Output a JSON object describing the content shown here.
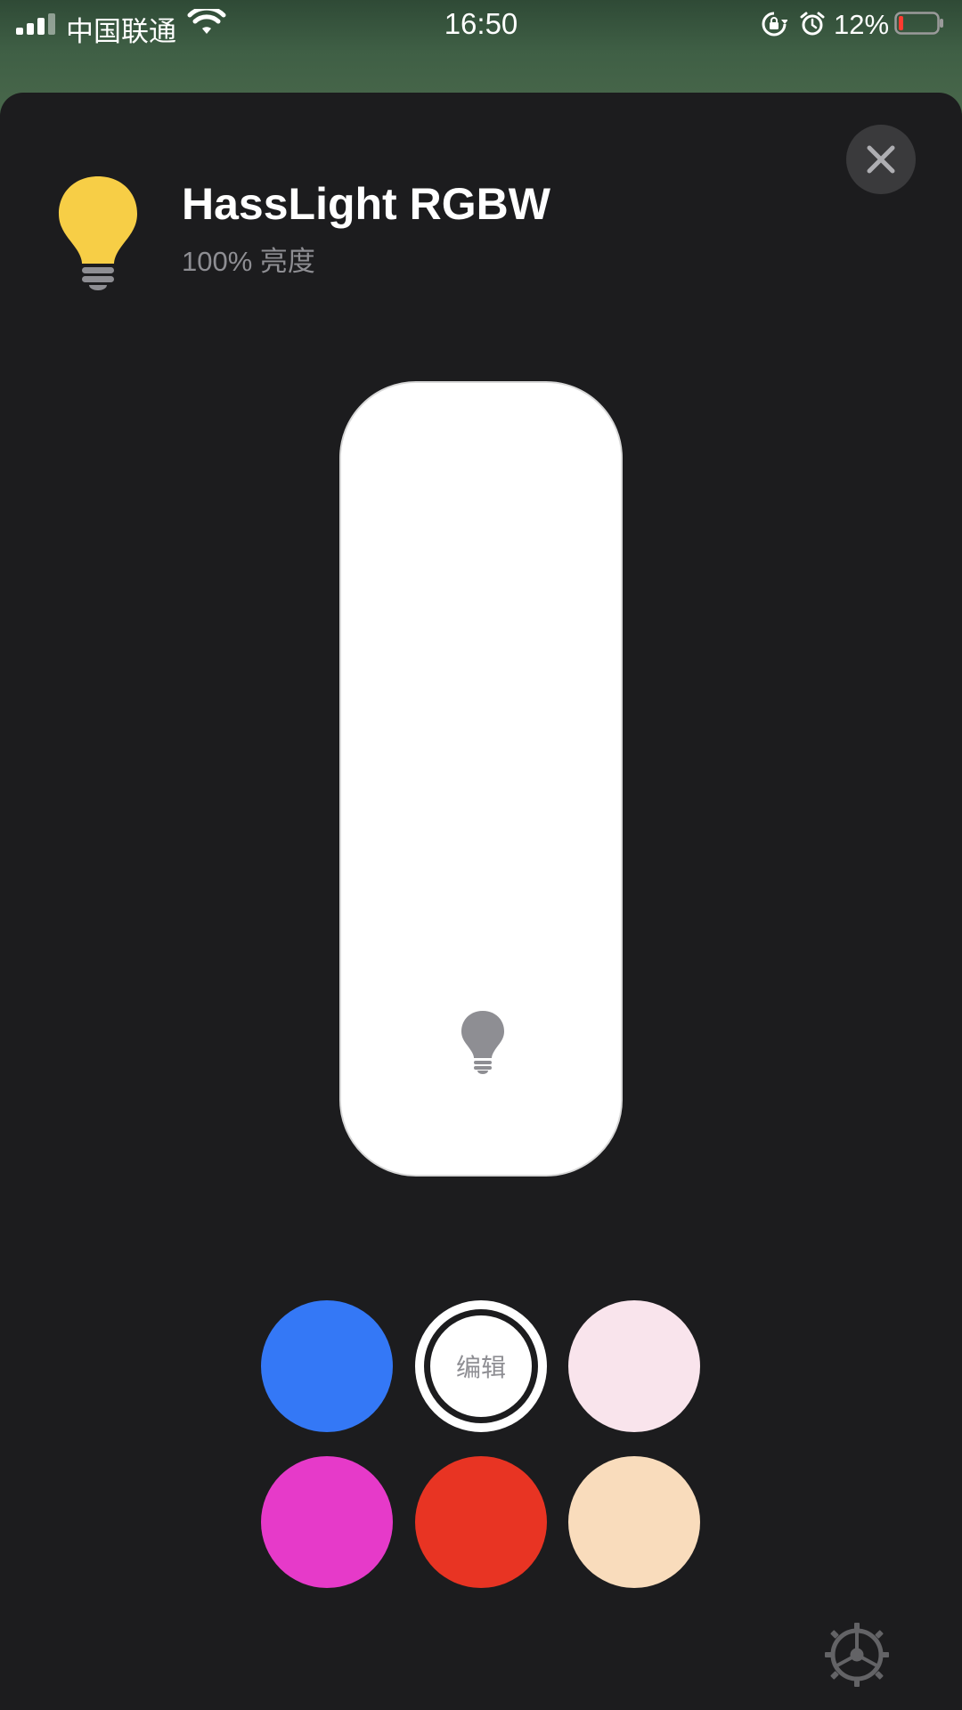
{
  "status_bar": {
    "carrier": "中国联通",
    "time": "16:50",
    "battery_percent": "12%",
    "icons": [
      "signal-icon",
      "wifi-icon",
      "rotation-lock-icon",
      "alarm-icon",
      "battery-icon"
    ]
  },
  "accessory": {
    "name": "HassLight RGBW",
    "status": "100% 亮度",
    "icon": "lightbulb-icon",
    "icon_color": "#F7CE46",
    "brightness": 1.0
  },
  "colors": {
    "sheet_background": "#1C1C1E",
    "slider_fill": "#FFFFFF"
  },
  "swatches": [
    {
      "name": "blue",
      "color": "#3478F6"
    },
    {
      "name": "edit",
      "label": "编辑",
      "color": "#FFFFFF"
    },
    {
      "name": "light-pink",
      "color": "#F9E4EC"
    },
    {
      "name": "magenta",
      "color": "#E63AC9"
    },
    {
      "name": "red",
      "color": "#E83423"
    },
    {
      "name": "peach",
      "color": "#F9DCBC"
    }
  ]
}
